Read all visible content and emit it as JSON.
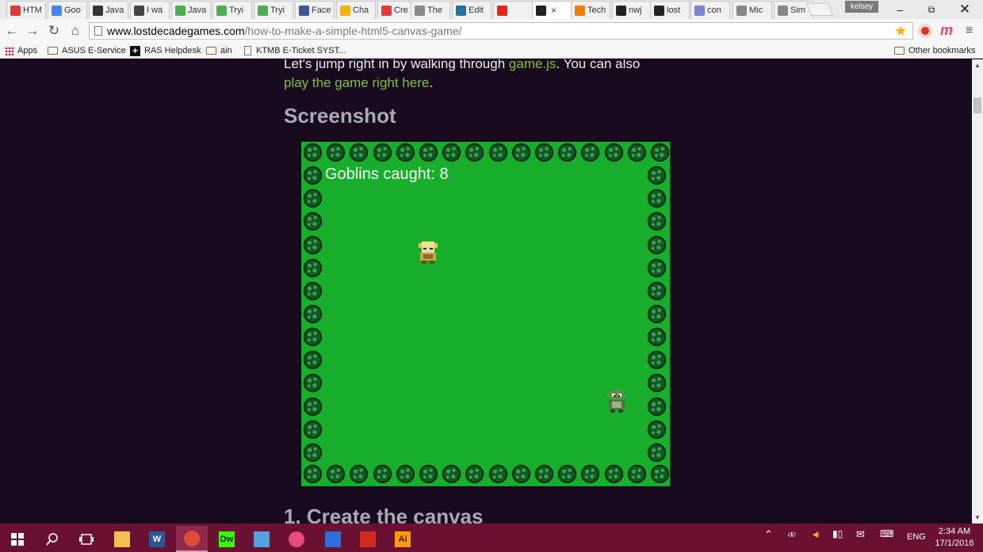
{
  "browser": {
    "tabs": [
      {
        "label": "HTM",
        "icon": "brackets-icon",
        "color": "#e53935"
      },
      {
        "label": "Goo",
        "icon": "google-icon",
        "color": "#4285f4"
      },
      {
        "label": "Java",
        "icon": "codepen-icon",
        "color": "#333333"
      },
      {
        "label": "I wa",
        "icon": "site-icon",
        "color": "#444444"
      },
      {
        "label": "Java",
        "icon": "w3schools-icon",
        "color": "#4caf50"
      },
      {
        "label": "Tryi",
        "icon": "w3schools-icon",
        "color": "#4caf50"
      },
      {
        "label": "Tryi",
        "icon": "w3schools-icon",
        "color": "#4caf50"
      },
      {
        "label": "Face",
        "icon": "facebook-icon",
        "color": "#3b5998"
      },
      {
        "label": "Cha",
        "icon": "pencil-icon",
        "color": "#f4b400"
      },
      {
        "label": "Cre",
        "icon": "brackets-icon",
        "color": "#e53935"
      },
      {
        "label": "The",
        "icon": "page-icon",
        "color": "#888888"
      },
      {
        "label": "Edit",
        "icon": "wordpress-icon",
        "color": "#21759b"
      },
      {
        "label": "",
        "icon": "youtube-icon",
        "color": "#e62117"
      },
      {
        "label": "",
        "icon": "site-icon",
        "color": "#222222"
      },
      {
        "label": "Tech",
        "icon": "blogger-icon",
        "color": "#f57d00"
      },
      {
        "label": "nwj",
        "icon": "github-icon",
        "color": "#222222"
      },
      {
        "label": "lost",
        "icon": "github-icon",
        "color": "#222222"
      },
      {
        "label": "con",
        "icon": "chart-icon",
        "color": "#7986cb"
      },
      {
        "label": "Mic",
        "icon": "page-icon",
        "color": "#888888"
      },
      {
        "label": "Sim",
        "icon": "page-icon",
        "color": "#888888"
      }
    ],
    "profile_name": "kelsey",
    "url_domain": "www.lostdecadegames.com",
    "url_path": "/how-to-make-a-simple-html5-canvas-game/",
    "bookmarks": [
      {
        "label": "Apps",
        "icon": "apps-grid-icon"
      },
      {
        "label": "ASUS E-Service",
        "icon": "folder-icon"
      },
      {
        "label": "RAS Helpdesk",
        "icon": "plus-icon"
      },
      {
        "label": "ain",
        "icon": "folder-icon"
      },
      {
        "label": "KTMB E-Ticket SYST...",
        "icon": "page-icon"
      }
    ],
    "other_bookmarks": "Other bookmarks"
  },
  "page": {
    "intro_text_1": "Let's jump right in by walking through ",
    "intro_link_1": "game.js",
    "intro_text_2": ". You can also",
    "intro_link_2": "play the game right here",
    "intro_text_3": ".",
    "heading_screenshot": "Screenshot",
    "heading_create": "1. Create the canvas",
    "game": {
      "score_label": "Goblins caught: 8",
      "background_color": "#16ae2a",
      "bush_color": "#0f5a24"
    }
  },
  "taskbar": {
    "apps": [
      {
        "name": "file-explorer",
        "label": "",
        "color": "#f2c14e"
      },
      {
        "name": "word",
        "label": "W",
        "color": "#2b5797"
      },
      {
        "name": "chrome",
        "label": "",
        "color": "#dd4b39"
      },
      {
        "name": "dreamweaver",
        "label": "Dw",
        "color": "#35fa00"
      },
      {
        "name": "control-panel",
        "label": "",
        "color": "#4fa3e0"
      },
      {
        "name": "itunes",
        "label": "",
        "color": "#e84a7f"
      },
      {
        "name": "wattpad-reader",
        "label": "",
        "color": "#2d6fd6"
      },
      {
        "name": "acrobat",
        "label": "",
        "color": "#d12a1c"
      },
      {
        "name": "illustrator",
        "label": "Ai",
        "color": "#ff9a00"
      }
    ],
    "language": "ENG",
    "time": "2:34 AM",
    "date": "17/1/2016"
  }
}
